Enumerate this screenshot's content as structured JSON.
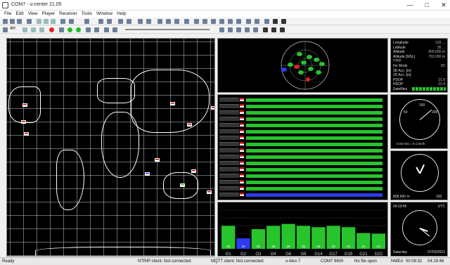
{
  "window": {
    "title": "COM7 - u-center 21.05",
    "controls": [
      "—",
      "□",
      "✕"
    ]
  },
  "menubar": [
    "File",
    "Edit",
    "View",
    "Player",
    "Receiver",
    "Tools",
    "Window",
    "Help"
  ],
  "toolbar2": {
    "sample": "4H"
  },
  "panels": {
    "map": "Map View",
    "sky": "Sky View",
    "signals": "Signal Level History",
    "levels": "Satellite Levels",
    "info": "Data View",
    "speed": "Speed",
    "altitude": "Altitude",
    "clock": "Clock"
  },
  "info": {
    "rows": [
      {
        "label": "Longitude",
        "value": "120 ..."
      },
      {
        "label": "Latitude",
        "value": "35 ..."
      },
      {
        "label": "Altitude",
        "value": "800.000 m"
      },
      {
        "label": "Altitude [MSL]",
        "value": "763.000 m"
      },
      {
        "label": "TTFF",
        "value": ""
      },
      {
        "label": "Fix Mode",
        "value": "3D"
      },
      {
        "label": "3D Acc. [m]",
        "value": ""
      },
      {
        "label": "2D Acc. [m]",
        "value": ""
      },
      {
        "label": "PDOP",
        "value": "21.9"
      },
      {
        "label": "HDOP",
        "value": "22.9"
      },
      {
        "label": "Satellites",
        "value": ""
      }
    ]
  },
  "speed": {
    "scale": [
      "0",
      "50",
      "100",
      "150",
      "200",
      "250",
      "300",
      "350"
    ],
    "readout": "0.03 m/s = 0.1 km/h",
    "speed_value": 0.1
  },
  "altitude": {
    "readout": "808.600 m",
    "scale_top": "1000",
    "scale_side": "100",
    "altitude_value": 808.6
  },
  "clock": {
    "time": "04:19:45",
    "zone": "UTC",
    "day": "Saturday",
    "date": "07/03/2021"
  },
  "levels": {
    "labels": [
      "G1",
      "G2",
      "G3",
      "G4",
      "G6",
      "G9",
      "G14",
      "G17",
      "G19",
      "G21",
      "G22"
    ],
    "values": [
      35,
      16,
      30,
      35,
      38,
      35,
      33,
      35,
      33,
      24,
      23
    ],
    "colors": {
      "used": "#27c42b",
      "weak": "#2b3bf0",
      "text": "#dddddd"
    }
  },
  "status": {
    "ready": "Ready",
    "ntrip": "NTRIP client: Not connected",
    "mqtt": "MQTT client: Not connected",
    "receiver": "u-blox 7",
    "port": "COM7 9600",
    "file": "No file open",
    "protocol": "NMEA",
    "clock": "00:08:32",
    "time": "04:19:46"
  },
  "colors": {
    "accent": "#27c42b",
    "map_background": "#000000",
    "grid": "#bbbbbb",
    "status_bg": "#e8e8e8"
  }
}
